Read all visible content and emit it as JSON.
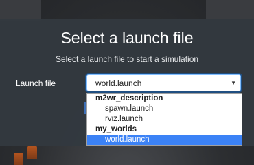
{
  "dialog": {
    "title": "Select a launch file",
    "subtitle": "Select a launch file to start a simulation",
    "field_label": "Launch file",
    "selected_value": "world.launch"
  },
  "dropdown": {
    "groups": [
      {
        "label": "m2wr_description",
        "items": [
          "spawn.launch",
          "rviz.launch"
        ]
      },
      {
        "label": "my_worlds",
        "items": [
          "world.launch"
        ]
      }
    ],
    "highlighted": "world.launch"
  },
  "colors": {
    "highlight": "#3b82f6",
    "modal_bg": "#33393f"
  },
  "icons": {
    "select_caret": "caret-down-icon"
  }
}
